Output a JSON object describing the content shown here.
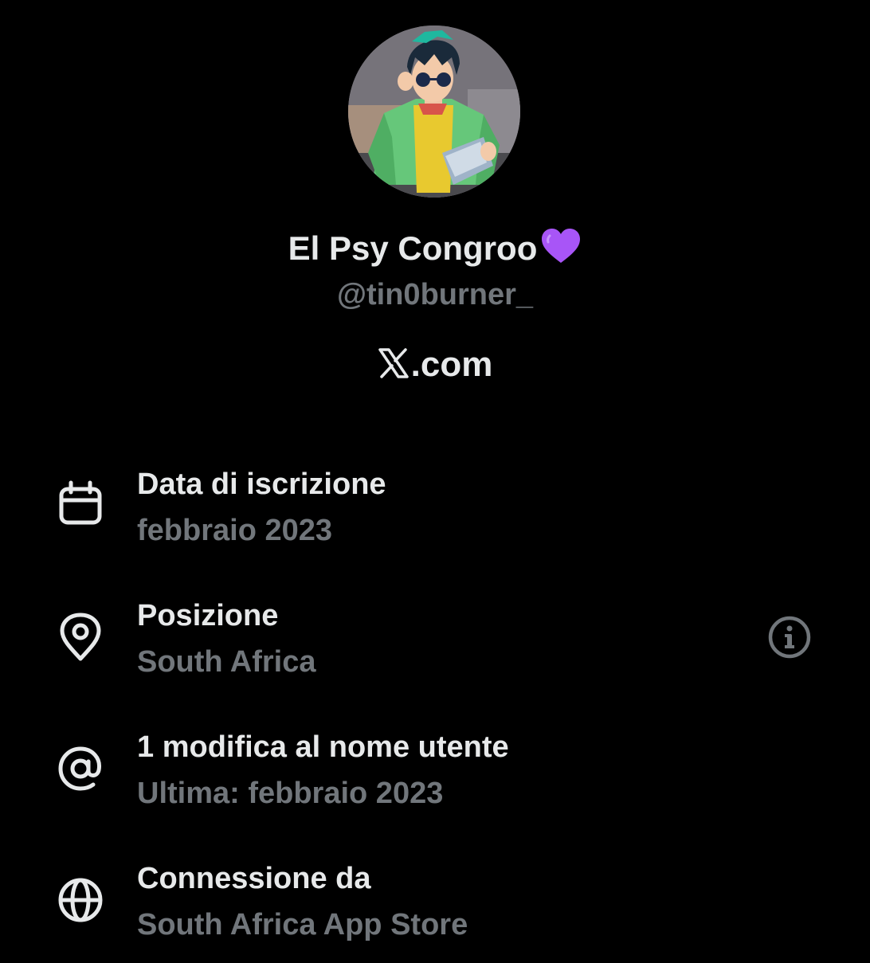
{
  "profile": {
    "display_name": "El Psy Congroo",
    "name_emoji": "purple-heart-icon",
    "handle": "@tin0burner_",
    "website": ".com",
    "website_logo": "x-logo-icon"
  },
  "colors": {
    "background": "#000000",
    "primary_text": "#e7e9ea",
    "secondary_text": "#71767b",
    "heart": "#a855f7"
  },
  "info": [
    {
      "icon": "calendar-icon",
      "title": "Data di iscrizione",
      "subtitle": "febbraio 2023"
    },
    {
      "icon": "location-pin-icon",
      "title": "Posizione",
      "subtitle": "South Africa",
      "action_icon": "info-icon"
    },
    {
      "icon": "at-sign-icon",
      "title": "1 modifica al nome utente",
      "subtitle": "Ultima: febbraio 2023"
    },
    {
      "icon": "globe-icon",
      "title": "Connessione da",
      "subtitle": "South Africa App Store"
    }
  ]
}
